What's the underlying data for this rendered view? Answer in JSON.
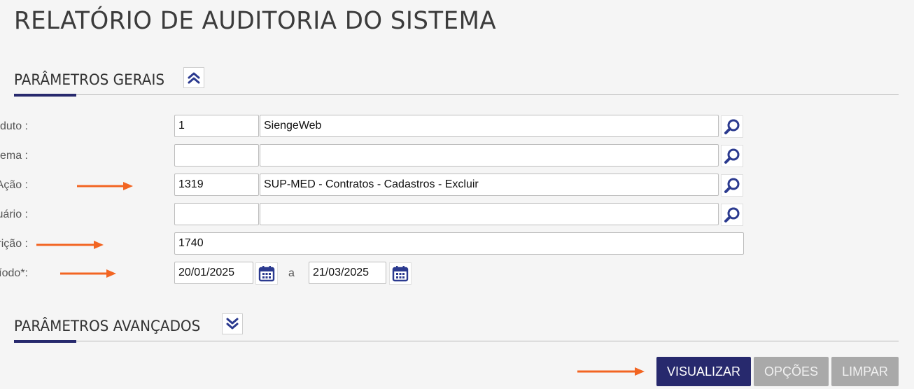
{
  "page": {
    "title": "RELATÓRIO DE AUDITORIA DO SISTEMA"
  },
  "sections": {
    "general": {
      "label": "PARÂMETROS GERAIS",
      "toggle_icon": "chevron-double-up-icon"
    },
    "advanced": {
      "label": "PARÂMETROS AVANÇADOS",
      "toggle_icon": "chevron-double-down-icon"
    }
  },
  "form": {
    "produto": {
      "label": "Produto :",
      "code": "1",
      "description": "SiengeWeb"
    },
    "sistema": {
      "label": "Sistema :",
      "code": "",
      "description": ""
    },
    "acao": {
      "label": "Ação :",
      "code": "1319",
      "description": "SUP-MED - Contratos - Cadastros - Excluir"
    },
    "usuario": {
      "label": "Usuário :",
      "code": "",
      "description": ""
    },
    "descricao": {
      "label": "Descrição :",
      "value": "1740"
    },
    "periodo": {
      "label": "Período*:",
      "start": "20/01/2025",
      "separator": "a",
      "end": "21/03/2025"
    }
  },
  "buttons": {
    "visualizar": "VISUALIZAR",
    "opcoes": "OPÇÕES",
    "limpar": "LIMPAR"
  },
  "colors": {
    "primary": "#27296d",
    "secondary": "#a9a9a9",
    "annotation_arrow": "#f26522",
    "icon": "#2b3a8f"
  }
}
